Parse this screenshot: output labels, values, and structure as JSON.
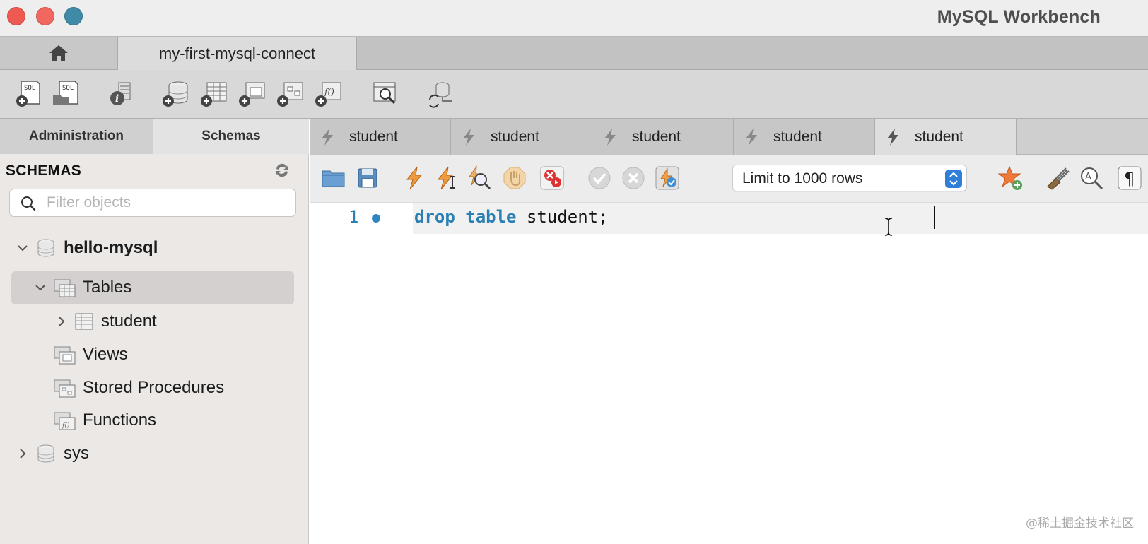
{
  "window": {
    "title": "MySQL Workbench"
  },
  "connection_tabs": {
    "home_icon": "home-icon",
    "active_connection": "my-first-mysql-connect"
  },
  "main_toolbar": {
    "icons": [
      "new-sql-tab-icon",
      "open-sql-script-icon",
      "server-info-icon",
      "create-schema-icon",
      "create-table-icon",
      "create-view-icon",
      "create-procedure-icon",
      "create-function-icon",
      "inspector-search-icon",
      "reconnect-icon"
    ]
  },
  "sidebar": {
    "tabs": {
      "administration": "Administration",
      "schemas": "Schemas"
    },
    "heading": "SCHEMAS",
    "filter_placeholder": "Filter objects",
    "tree": {
      "schema1": "hello-mysql",
      "tables": "Tables",
      "table1": "student",
      "views": "Views",
      "procedures": "Stored Procedures",
      "functions": "Functions",
      "schema2": "sys"
    }
  },
  "query_tabs": [
    "student",
    "student",
    "student",
    "student",
    "student"
  ],
  "editor_toolbar": {
    "limit": "Limit to 1000 rows"
  },
  "editor": {
    "line_number": "1",
    "code_kw1": "drop",
    "code_kw2": "table",
    "code_rest": "student;"
  },
  "watermark": "@稀土掘金技术社区",
  "colors": {
    "keyword": "#2a7fb3",
    "accent": "#2f7fd9"
  }
}
